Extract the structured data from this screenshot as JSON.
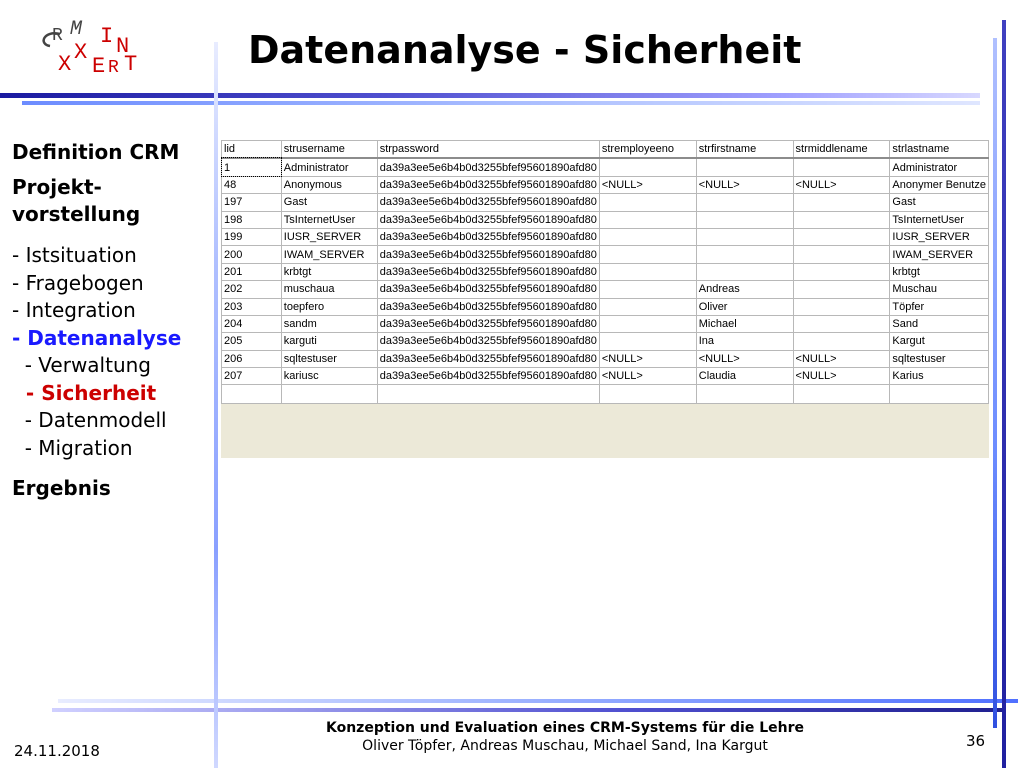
{
  "slide": {
    "title": "Datenanalyse - Sicherheit",
    "logo_letters": [
      "C",
      "R",
      "M",
      "I",
      "N",
      "X",
      "X",
      "E",
      "R",
      "T"
    ]
  },
  "nav": {
    "h1": "Definition CRM",
    "h2a": "Projekt-",
    "h2b": "vorstellung",
    "items": [
      "- Istsituation",
      "- Fragebogen",
      "- Integration",
      "- Datenanalyse",
      "  - Verwaltung",
      "  - Sicherheit",
      "  - Datenmodell",
      "  - Migration"
    ],
    "h3": "Ergebnis"
  },
  "colors": {
    "active": "#1a1aff",
    "current": "#cc0000",
    "logo_red": "#cc0000"
  },
  "table": {
    "columns": [
      "lid",
      "strusername",
      "strpassword",
      "stremployeeno",
      "strfirstname",
      "strmiddlename",
      "strlastname"
    ],
    "rows": [
      [
        "1",
        "Administrator",
        "da39a3ee5e6b4b0d3255bfef95601890afd80",
        "",
        "",
        "",
        "Administrator"
      ],
      [
        "48",
        "Anonymous",
        "da39a3ee5e6b4b0d3255bfef95601890afd80",
        "<NULL>",
        "<NULL>",
        "<NULL>",
        "Anonymer Benutze"
      ],
      [
        "197",
        "Gast",
        "da39a3ee5e6b4b0d3255bfef95601890afd80",
        "",
        "",
        "",
        "Gast"
      ],
      [
        "198",
        "TsInternetUser",
        "da39a3ee5e6b4b0d3255bfef95601890afd80",
        "",
        "",
        "",
        "TsInternetUser"
      ],
      [
        "199",
        "IUSR_SERVER",
        "da39a3ee5e6b4b0d3255bfef95601890afd80",
        "",
        "",
        "",
        "IUSR_SERVER"
      ],
      [
        "200",
        "IWAM_SERVER",
        "da39a3ee5e6b4b0d3255bfef95601890afd80",
        "",
        "",
        "",
        "IWAM_SERVER"
      ],
      [
        "201",
        "krbtgt",
        "da39a3ee5e6b4b0d3255bfef95601890afd80",
        "",
        "",
        "",
        "krbtgt"
      ],
      [
        "202",
        "muschaua",
        "da39a3ee5e6b4b0d3255bfef95601890afd80",
        "",
        "Andreas",
        "",
        "Muschau"
      ],
      [
        "203",
        "toepfero",
        "da39a3ee5e6b4b0d3255bfef95601890afd80",
        "",
        "Oliver",
        "",
        "Töpfer"
      ],
      [
        "204",
        "sandm",
        "da39a3ee5e6b4b0d3255bfef95601890afd80",
        "",
        "Michael",
        "",
        "Sand"
      ],
      [
        "205",
        "karguti",
        "da39a3ee5e6b4b0d3255bfef95601890afd80",
        "",
        "Ina",
        "",
        "Kargut"
      ],
      [
        "206",
        "sqltestuser",
        "da39a3ee5e6b4b0d3255bfef95601890afd80",
        "<NULL>",
        "<NULL>",
        "<NULL>",
        "sqltestuser"
      ],
      [
        "207",
        "kariusc",
        "da39a3ee5e6b4b0d3255bfef95601890afd80",
        "<NULL>",
        "Claudia",
        "<NULL>",
        "Karius"
      ]
    ]
  },
  "footer": {
    "date": "24.11.2018",
    "line1": "Konzeption und Evaluation eines CRM-Systems für die Lehre",
    "line2": "Oliver Töpfer, Andreas Muschau, Michael Sand, Ina Kargut",
    "page": "36"
  }
}
